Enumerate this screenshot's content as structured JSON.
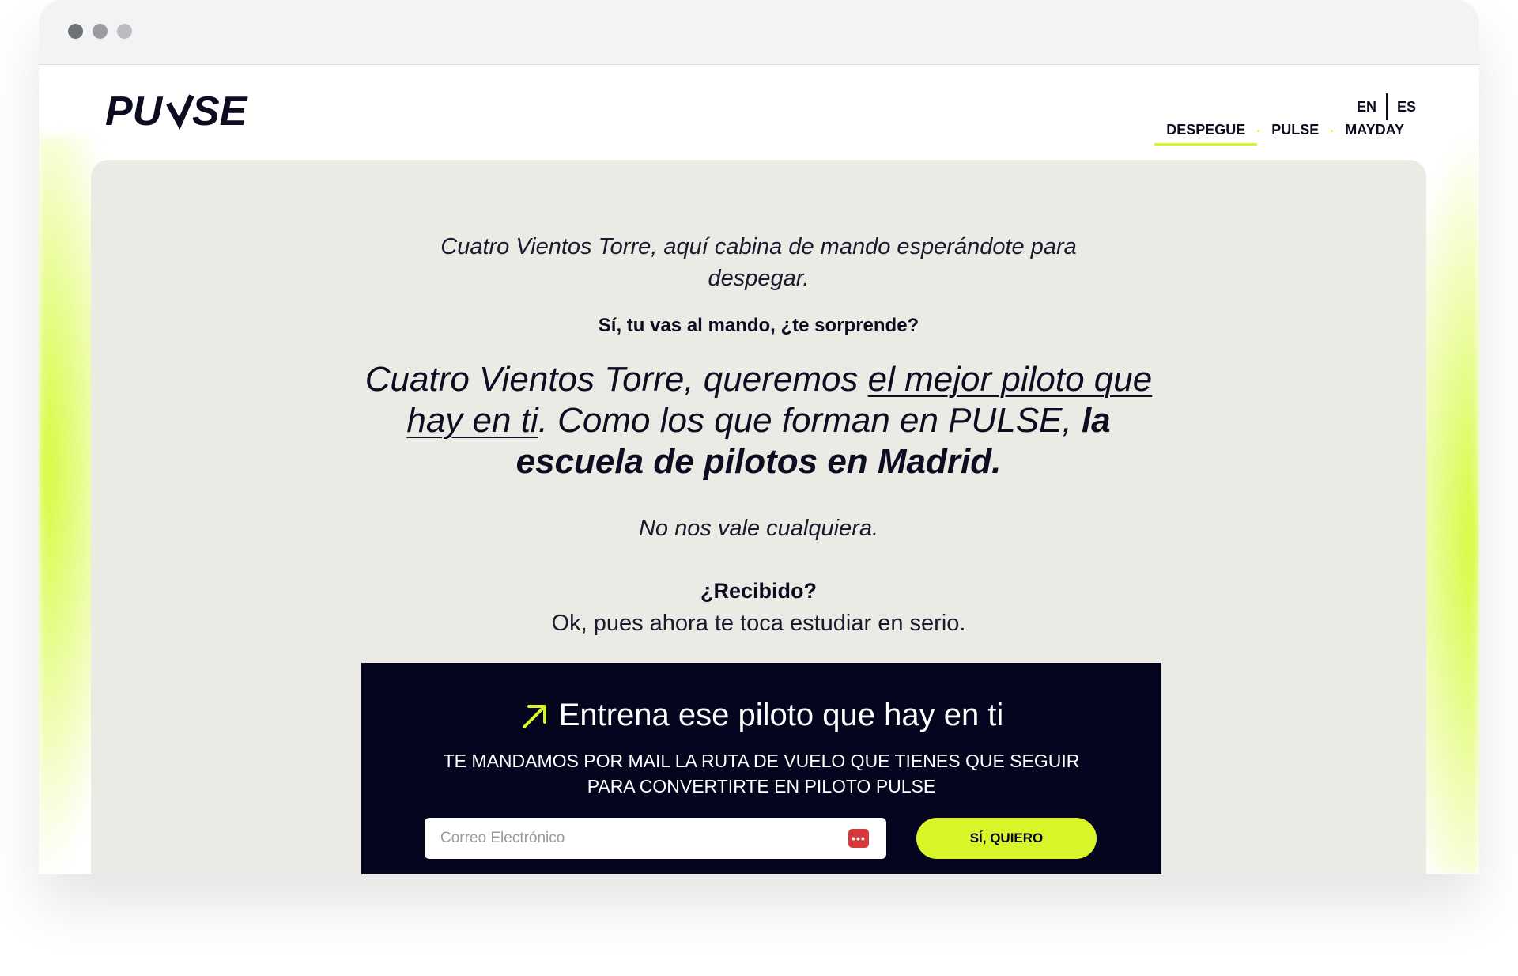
{
  "brand": {
    "logo_text": "PULSE",
    "accent_color": "#d8f52a",
    "dark_color": "#05051f"
  },
  "lang": {
    "en": "EN",
    "es": "ES"
  },
  "nav": {
    "items": [
      {
        "label": "DESPEGUE",
        "active": true
      },
      {
        "label": "PULSE",
        "active": false
      },
      {
        "label": "MAYDAY",
        "active": false
      }
    ]
  },
  "hero": {
    "intro": "Cuatro Vientos Torre, aquí cabina de mando esperándote para despegar.",
    "question": "Sí, tu vas al mando, ¿te sorprende?",
    "big_part1": "Cuatro Vientos Torre, queremos ",
    "big_underline": "el mejor piloto que hay en ti",
    "big_part2": ". Como los que forman en PULSE, ",
    "big_bold": "la escuela de pilotos en Madrid.",
    "no_vale": "No nos vale cualquiera.",
    "recibido": "¿Recibido?",
    "estudiar": "Ok, pues ahora te toca estudiar en serio."
  },
  "cta": {
    "arrow_icon": "arrow-up-right-icon",
    "title": "Entrena ese piloto que hay en ti",
    "subtitle": "TE MANDAMOS POR MAIL LA RUTA DE VUELO QUE TIENES QUE SEGUIR PARA CONVERTIRTE EN PILOTO PULSE",
    "email_placeholder": "Correo Electrónico",
    "email_value": "",
    "button_label": "SÍ, QUIERO"
  }
}
